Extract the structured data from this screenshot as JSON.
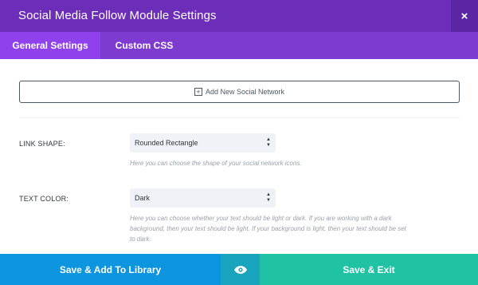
{
  "modal": {
    "title": "Social Media Follow Module Settings",
    "close_icon": "×"
  },
  "tabs": [
    {
      "label": "General Settings",
      "active": true
    },
    {
      "label": "Custom CSS",
      "active": false
    }
  ],
  "add_network": {
    "icon": "+",
    "label": "Add New Social Network"
  },
  "settings": {
    "link_shape": {
      "label": "LINK SHAPE:",
      "value": "Rounded Rectangle",
      "description": "Here you can choose the shape of your social network icons."
    },
    "text_color": {
      "label": "TEXT COLOR:",
      "value": "Dark",
      "description_lines": [
        "Here you can choose whether your text should be light or dark. If you are working with a dark",
        "background, then your text should be light. If your background is light, then your text should be set",
        "to dark."
      ]
    }
  },
  "footer": {
    "save_library": "Save & Add To Library",
    "preview_icon": "eye-icon",
    "save_exit": "Save & Exit"
  },
  "colors": {
    "header": "#6c2eb9",
    "tabs": "#7e3bd0",
    "active_tab": "#8f42ec",
    "save_library": "#0d95e0",
    "preview": "#19a4bd",
    "save_exit": "#1fc2a3"
  }
}
